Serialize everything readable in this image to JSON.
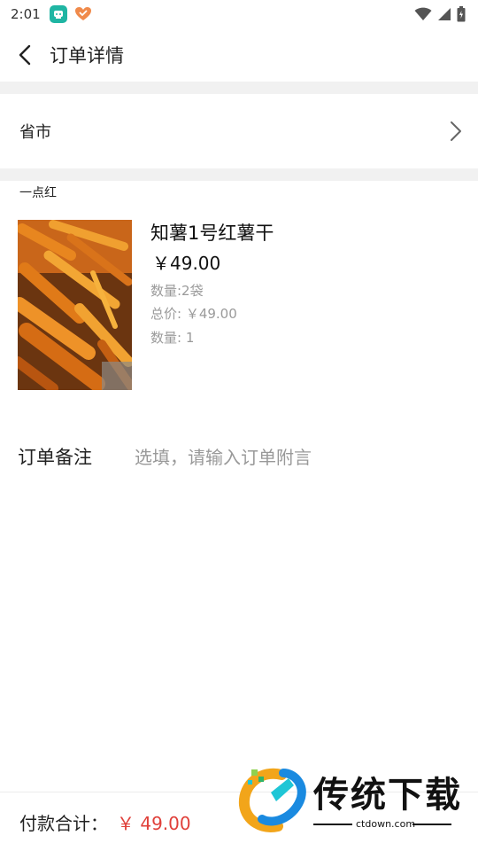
{
  "status_bar": {
    "time": "2:01"
  },
  "header": {
    "title": "订单详情"
  },
  "address": {
    "text": "省市"
  },
  "store": {
    "name": "一点红"
  },
  "product": {
    "name": "知薯1号红薯干",
    "price": "￥49.00",
    "spec": "数量:2袋",
    "total": "总价: ￥49.00",
    "quantity": "数量: 1"
  },
  "remark": {
    "label": "订单备注",
    "placeholder": "选填，请输入订单附言"
  },
  "footer": {
    "label": "付款合计：",
    "total": "￥ 49.00",
    "total_color": "#e0403a"
  },
  "watermark": {
    "brand": "传统下载",
    "url": "ctdown.com"
  }
}
